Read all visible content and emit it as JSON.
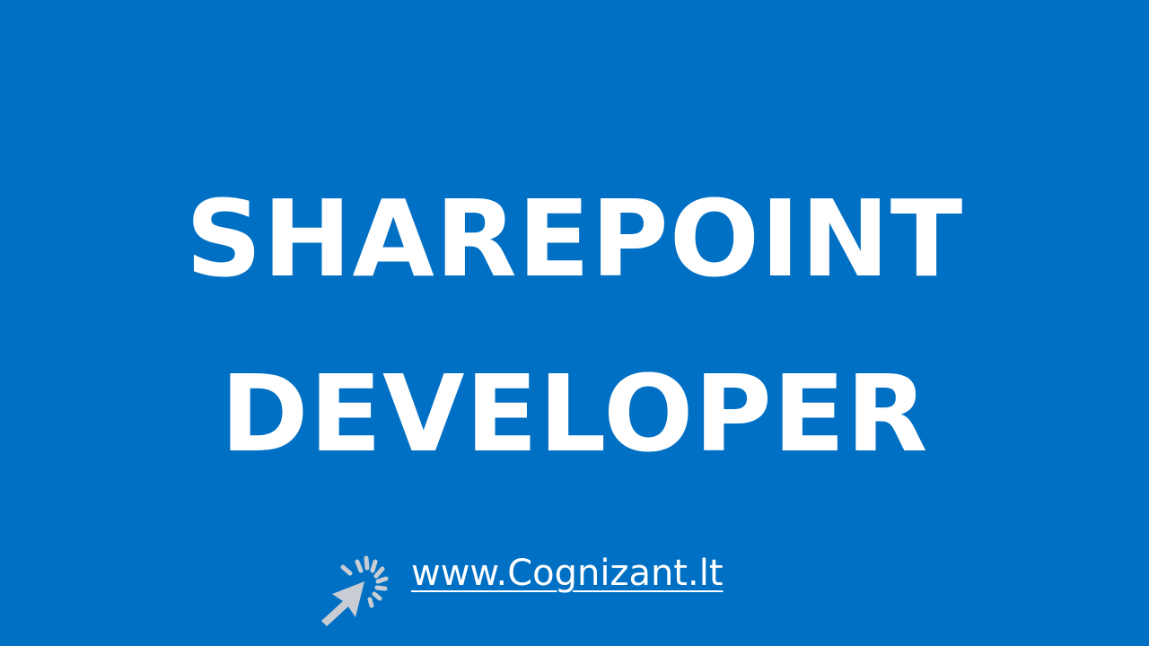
{
  "headline": {
    "line1": "SHAREPOINT",
    "line2": "DEVELOPER"
  },
  "footer": {
    "link_text": "www.Cognizant.lt",
    "icon": "click-cursor-icon"
  },
  "colors": {
    "background": "#0070c4",
    "text": "#ffffff",
    "icon": "#c8cdd3"
  }
}
